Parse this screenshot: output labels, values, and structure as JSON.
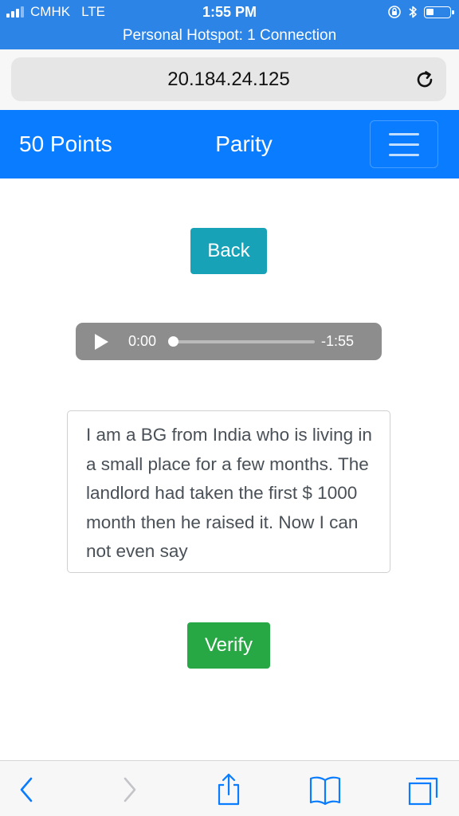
{
  "status_bar": {
    "carrier": "CMHK",
    "network": "LTE",
    "time": "1:55 PM",
    "hotspot": "Personal Hotspot: 1 Connection"
  },
  "browser": {
    "url": "20.184.24.125"
  },
  "navbar": {
    "points": "50 Points",
    "title": "Parity"
  },
  "content": {
    "back_label": "Back",
    "audio": {
      "current_time": "0:00",
      "remaining_time": "-1:55",
      "progress": 0
    },
    "passage": "I am a BG from India who is living in a small place for a few months. The landlord had taken the first $ 1000 month then he raised it. Now I can not even say",
    "verify_label": "Verify"
  },
  "colors": {
    "status_bar_bg": "#2b84e6",
    "navbar_bg": "#0a7cff",
    "back_button": "#17a2b8",
    "verify_button": "#28a745",
    "audio_player": "#8d8d8d",
    "toolbar_tint": "#0a7cff"
  },
  "icons": {
    "reload": "reload-icon",
    "menu": "hamburger-menu-icon",
    "back": "chevron-left-icon",
    "forward": "chevron-right-icon",
    "share": "share-icon",
    "bookmarks": "book-icon",
    "tabs": "tabs-icon"
  }
}
